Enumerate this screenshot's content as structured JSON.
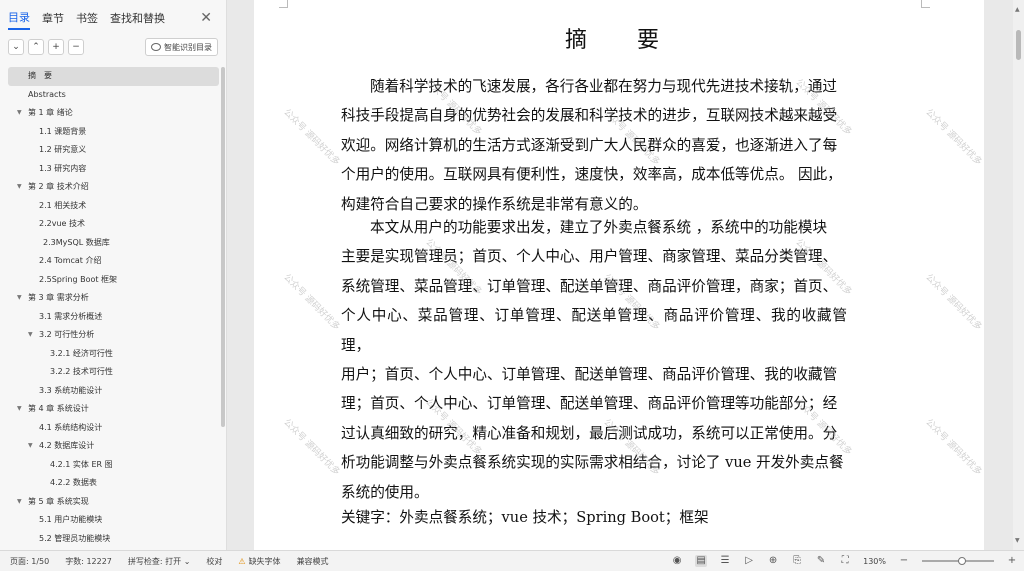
{
  "sidebar": {
    "tabs": [
      {
        "label": "目录",
        "active": true
      },
      {
        "label": "章节"
      },
      {
        "label": "书签"
      },
      {
        "label": "查找和替换"
      }
    ],
    "close": "✕",
    "tools": [
      "⌄",
      "⌃",
      "+",
      "−"
    ],
    "smart_toc": "智能识别目录",
    "toc": [
      {
        "label": "摘　要",
        "level": 0,
        "selected": true
      },
      {
        "label": "Abstracts",
        "level": 0
      },
      {
        "label": "第 1 章  绪论",
        "level": 0,
        "expanded": true
      },
      {
        "label": "1.1 课题背景",
        "level": 1
      },
      {
        "label": "1.2 研究意义",
        "level": 1
      },
      {
        "label": "1.3 研究内容",
        "level": 1
      },
      {
        "label": "第 2 章  技术介绍",
        "level": 0,
        "expanded": true
      },
      {
        "label": "2.1 相关技术",
        "level": 1
      },
      {
        "label": "2.2vue 技术",
        "level": 1
      },
      {
        "label": "2.3MySQL 数据库",
        "level": 1.3
      },
      {
        "label": "2.4 Tomcat 介绍",
        "level": 1
      },
      {
        "label": "2.5Spring Boot 框架",
        "level": 1
      },
      {
        "label": "第 3 章  需求分析",
        "level": 0,
        "expanded": true
      },
      {
        "label": "3.1 需求分析概述",
        "level": 1
      },
      {
        "label": "3.2 可行性分析",
        "level": 1,
        "expanded": true
      },
      {
        "label": "3.2.1 经济可行性",
        "level": 2
      },
      {
        "label": "3.2.2 技术可行性",
        "level": 2
      },
      {
        "label": "3.3 系统功能设计",
        "level": 1
      },
      {
        "label": "第 4 章  系统设计",
        "level": 0,
        "expanded": true
      },
      {
        "label": "4.1 系统结构设计",
        "level": 1
      },
      {
        "label": "4.2 数据库设计",
        "level": 1,
        "expanded": true
      },
      {
        "label": "4.2.1 实体 ER 图",
        "level": 2
      },
      {
        "label": "4.2.2 数据表",
        "level": 2
      },
      {
        "label": "第 5 章  系统实现",
        "level": 0,
        "expanded": true
      },
      {
        "label": "5.1 用户功能模块",
        "level": 1
      },
      {
        "label": "5.2 管理员功能模块",
        "level": 1
      }
    ]
  },
  "document": {
    "title": "摘　要",
    "paragraph1_lines": [
      "随着科学技术的飞速发展，各行各业都在努力与现代先进技术接轨，通过",
      "科技手段提高自身的优势社会的发展和科学技术的进步，互联网技术越来越受",
      "欢迎。网络计算机的生活方式逐渐受到广大人民群众的喜爱，也逐渐进入了每",
      "个用户的使用。互联网具有便利性，速度快，效率高，成本低等优点。 因此，",
      "构建符合自己要求的操作系统是非常有意义的。"
    ],
    "paragraph2_lines": [
      "本文从用户的功能要求出发，建立了外卖点餐系统 ，系统中的功能模块",
      "主要是实现管理员；首页、个人中心、用户管理、商家管理、菜品分类管理、",
      "系统管理、菜品管理、订单管理、配送单管理、商品评价管理，商家；首页、",
      "个人中心、菜品管理、订单管理、配送单管理、商品评价管理、我的收藏管理，",
      "用户；首页、个人中心、订单管理、配送单管理、商品评价管理、我的收藏管",
      "理；首页、个人中心、订单管理、配送单管理、商品评价管理等功能部分；经",
      "过认真细致的研究，精心准备和规划，最后测试成功，系统可以正常使用。分",
      "析功能调整与外卖点餐系统实现的实际需求相结合，讨论了 vue 开发外卖点餐",
      "系统的使用。"
    ],
    "keywords_label": "关键字：",
    "keywords": "外卖点餐系统；vue 技术；Spring Boot；框架",
    "watermark": "公众号 源码好优多"
  },
  "statusbar": {
    "page": "页面: 1/50",
    "words": "字数: 12227",
    "spell": "拼写检查: 打开",
    "spell_arrow": "⌄",
    "proofread": "校对",
    "missing_font": "缺失字体",
    "compat": "兼容模式",
    "zoom": "130%",
    "zoom_level_fraction": 0.55
  },
  "colors": {
    "accent": "#1a64e8",
    "warning": "#e08a00"
  }
}
